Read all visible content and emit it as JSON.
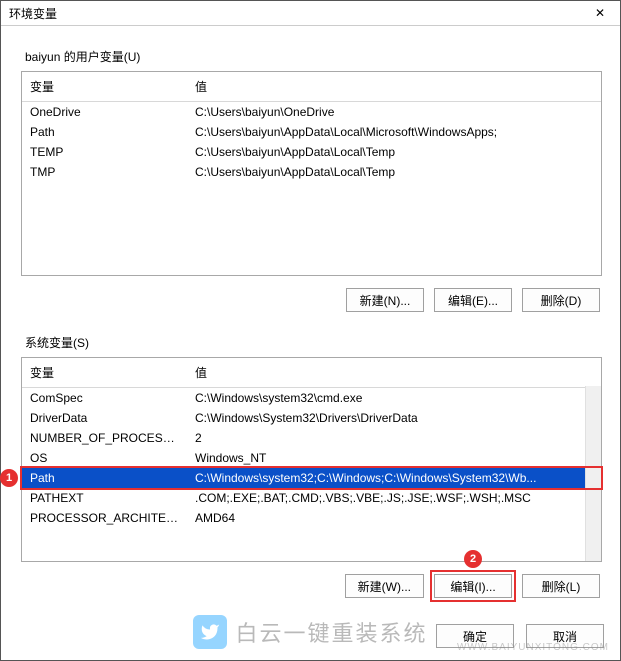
{
  "window": {
    "title": "环境变量"
  },
  "user": {
    "label": "baiyun 的用户变量(U)",
    "headers": {
      "var": "变量",
      "val": "值"
    },
    "rows": [
      {
        "var": "OneDrive",
        "val": "C:\\Users\\baiyun\\OneDrive"
      },
      {
        "var": "Path",
        "val": "C:\\Users\\baiyun\\AppData\\Local\\Microsoft\\WindowsApps;"
      },
      {
        "var": "TEMP",
        "val": "C:\\Users\\baiyun\\AppData\\Local\\Temp"
      },
      {
        "var": "TMP",
        "val": "C:\\Users\\baiyun\\AppData\\Local\\Temp"
      }
    ],
    "buttons": {
      "new": "新建(N)...",
      "edit": "编辑(E)...",
      "delete": "删除(D)"
    }
  },
  "system": {
    "label": "系统变量(S)",
    "headers": {
      "var": "变量",
      "val": "值"
    },
    "rows": [
      {
        "var": "ComSpec",
        "val": "C:\\Windows\\system32\\cmd.exe"
      },
      {
        "var": "DriverData",
        "val": "C:\\Windows\\System32\\Drivers\\DriverData"
      },
      {
        "var": "NUMBER_OF_PROCESSORS",
        "val": "2"
      },
      {
        "var": "OS",
        "val": "Windows_NT"
      },
      {
        "var": "Path",
        "val": "C:\\Windows\\system32;C:\\Windows;C:\\Windows\\System32\\Wb..."
      },
      {
        "var": "PATHEXT",
        "val": ".COM;.EXE;.BAT;.CMD;.VBS;.VBE;.JS;.JSE;.WSF;.WSH;.MSC"
      },
      {
        "var": "PROCESSOR_ARCHITECT...",
        "val": "AMD64"
      }
    ],
    "selected_index": 4,
    "buttons": {
      "new": "新建(W)...",
      "edit": "编辑(I)...",
      "delete": "删除(L)"
    }
  },
  "dialog_buttons": {
    "ok": "确定",
    "cancel": "取消"
  },
  "callouts": {
    "one": "1",
    "two": "2"
  },
  "watermark": {
    "text": "白云一键重装系统",
    "url": "WWW.BAIYUNXITONG.COM"
  }
}
